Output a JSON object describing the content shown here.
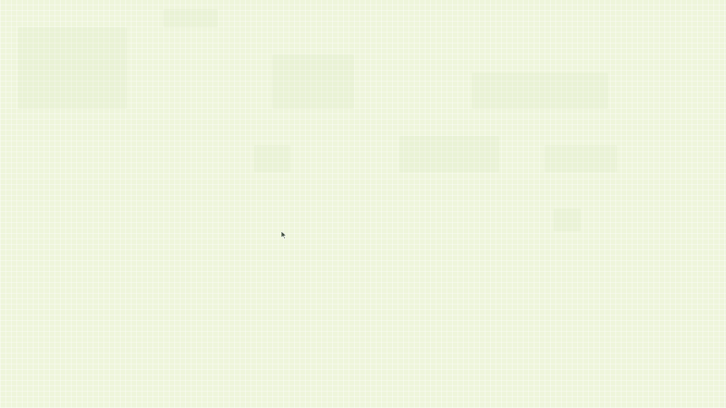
{
  "screen": {
    "background_color": "#eef5db",
    "grid_line_color": "#ffffff"
  },
  "cursor": {
    "icon": "arrow-pointer-icon",
    "color": "#3b4a3a"
  }
}
